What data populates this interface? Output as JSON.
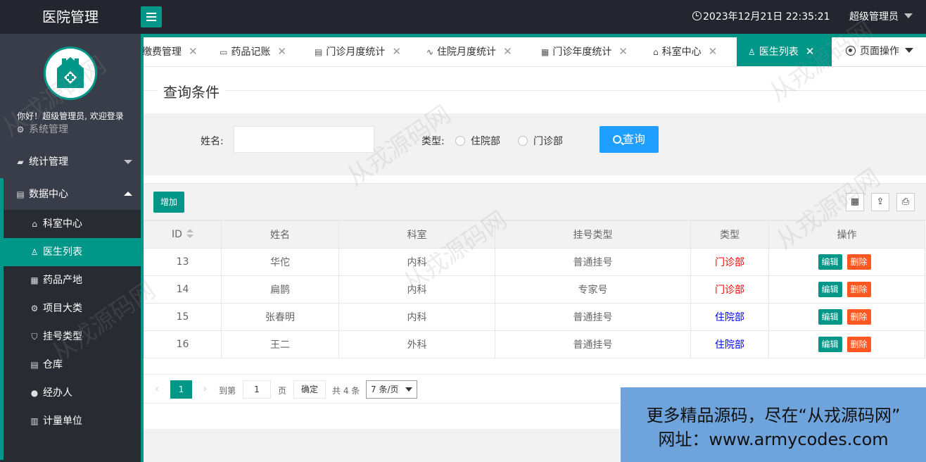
{
  "header": {
    "title": "医院管理",
    "datetime": "2023年12月21日 22:35:21",
    "user": "超级管理员"
  },
  "sidebar": {
    "welcome": "你好！超级管理员, 欢迎登录",
    "partial_item": "系统管理",
    "groups": [
      {
        "label": "统计管理",
        "icon": "chart-icon"
      },
      {
        "label": "数据中心",
        "icon": "file-icon"
      }
    ],
    "items": [
      {
        "label": "科室中心",
        "icon": "home-icon"
      },
      {
        "label": "医生列表",
        "icon": "user-icon"
      },
      {
        "label": "药品产地",
        "icon": "building-icon"
      },
      {
        "label": "项目大类",
        "icon": "gear-icon"
      },
      {
        "label": "挂号类型",
        "icon": "shield-icon"
      },
      {
        "label": "仓库",
        "icon": "doc-icon"
      },
      {
        "label": "经办人",
        "icon": "person-icon"
      },
      {
        "label": "计量单位",
        "icon": "calendar-icon"
      }
    ]
  },
  "tabs": [
    {
      "label": "缴费管理"
    },
    {
      "label": "药品记账"
    },
    {
      "label": "门诊月度统计"
    },
    {
      "label": "住院月度统计"
    },
    {
      "label": "门诊年度统计"
    },
    {
      "label": "科室中心"
    },
    {
      "label": "医生列表"
    }
  ],
  "page_ops": "页面操作",
  "query": {
    "title": "查询条件",
    "name_label": "姓名:",
    "name_value": "",
    "type_label": "类型:",
    "options": [
      "住院部",
      "门诊部"
    ],
    "button": "查询"
  },
  "toolbar": {
    "add_label": "增加"
  },
  "table": {
    "headers": [
      "ID",
      "姓名",
      "科室",
      "挂号类型",
      "类型",
      "操作"
    ],
    "rows": [
      {
        "id": "13",
        "name": "华佗",
        "dept": "内科",
        "reg": "普通挂号",
        "type": "门诊部"
      },
      {
        "id": "14",
        "name": "扁鹊",
        "dept": "内科",
        "reg": "专家号",
        "type": "门诊部"
      },
      {
        "id": "15",
        "name": "张春明",
        "dept": "内科",
        "reg": "普通挂号",
        "type": "住院部"
      },
      {
        "id": "16",
        "name": "王二",
        "dept": "外科",
        "reg": "普通挂号",
        "type": "住院部"
      }
    ],
    "edit_label": "编辑",
    "delete_label": "删除"
  },
  "pager": {
    "current": "1",
    "goto_prefix": "到第",
    "goto_value": "1",
    "page_suffix": "页",
    "confirm": "确定",
    "total": "共 4 条",
    "page_size": "7 条/页"
  },
  "ad": {
    "line1": "更多精品源码，尽在“从戎源码网”",
    "line2": "网址：www.armycodes.com"
  },
  "watermark": "从戎源码网",
  "colors": {
    "header_bg": "#23262e",
    "sidebar_bg": "#393d49",
    "accent": "#009688",
    "query_button": "#1e9fff",
    "delete_button": "#ff5722",
    "outpatient_color": "#ff0000",
    "inpatient_color": "#0000ff"
  }
}
